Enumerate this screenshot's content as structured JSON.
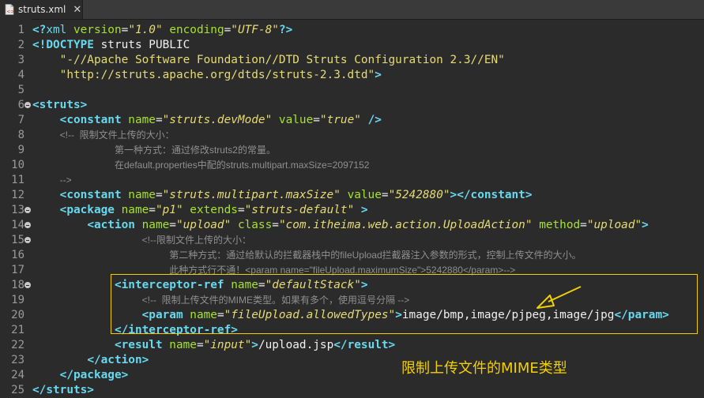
{
  "tab": {
    "title": "struts.xml",
    "close": "✕"
  },
  "lines": [
    {
      "n": "1",
      "indent": "",
      "segs": [
        [
          "t-tag",
          "<?"
        ],
        [
          "t-kw",
          "xml "
        ],
        [
          "t-attr",
          "version"
        ],
        [
          "t-b",
          "="
        ],
        [
          "t-val",
          "\"1.0\""
        ],
        [
          "t-b",
          " "
        ],
        [
          "t-attr",
          "encoding"
        ],
        [
          "t-b",
          "="
        ],
        [
          "t-val",
          "\"UTF-8\""
        ],
        [
          "t-tag",
          "?>"
        ]
      ]
    },
    {
      "n": "2",
      "indent": "",
      "segs": [
        [
          "t-tag",
          "<!DOCTYPE "
        ],
        [
          "t-b",
          "struts PUBLIC"
        ]
      ]
    },
    {
      "n": "3",
      "indent": "    ",
      "segs": [
        [
          "t-str",
          "\"-//Apache Software Foundation//DTD Struts Configuration 2.3//EN\""
        ]
      ]
    },
    {
      "n": "4",
      "indent": "    ",
      "segs": [
        [
          "t-str",
          "\"http://struts.apache.org/dtds/struts-2.3.dtd\""
        ],
        [
          "t-tag",
          ">"
        ]
      ]
    },
    {
      "n": "5",
      "indent": "",
      "segs": []
    },
    {
      "n": "6",
      "indent": "",
      "fold": true,
      "segs": [
        [
          "t-tag",
          "<struts>"
        ]
      ]
    },
    {
      "n": "7",
      "indent": "    ",
      "segs": [
        [
          "t-tag",
          "<constant "
        ],
        [
          "t-attr",
          "name"
        ],
        [
          "t-b",
          "="
        ],
        [
          "t-val",
          "\"struts.devMode\""
        ],
        [
          "t-b",
          " "
        ],
        [
          "t-attr",
          "value"
        ],
        [
          "t-b",
          "="
        ],
        [
          "t-val",
          "\"true\""
        ],
        [
          "t-b",
          " "
        ],
        [
          "t-tag",
          "/>"
        ]
      ]
    },
    {
      "n": "8",
      "indent": "    ",
      "comment": true,
      "segs": [
        [
          "t-c",
          "<!--  限制文件上传的大小："
        ]
      ]
    },
    {
      "n": "9",
      "indent": "            ",
      "comment": true,
      "segs": [
        [
          "t-c",
          "第一种方式：通过修改struts2的常量。"
        ]
      ]
    },
    {
      "n": "10",
      "indent": "            ",
      "comment": true,
      "segs": [
        [
          "t-c",
          "在default.properties中配的struts.multipart.maxSize=2097152"
        ]
      ]
    },
    {
      "n": "11",
      "indent": "    ",
      "comment": true,
      "segs": [
        [
          "t-c",
          "-->"
        ]
      ]
    },
    {
      "n": "12",
      "indent": "    ",
      "segs": [
        [
          "t-tag",
          "<constant "
        ],
        [
          "t-attr",
          "name"
        ],
        [
          "t-b",
          "="
        ],
        [
          "t-val",
          "\"struts.multipart.maxSize\""
        ],
        [
          "t-b",
          " "
        ],
        [
          "t-attr",
          "value"
        ],
        [
          "t-b",
          "="
        ],
        [
          "t-val",
          "\"5242880\""
        ],
        [
          "t-tag",
          "></constant>"
        ]
      ]
    },
    {
      "n": "13",
      "indent": "    ",
      "fold": true,
      "segs": [
        [
          "t-tag",
          "<package "
        ],
        [
          "t-attr",
          "name"
        ],
        [
          "t-b",
          "="
        ],
        [
          "t-val",
          "\"p1\""
        ],
        [
          "t-b",
          " "
        ],
        [
          "t-attr",
          "extends"
        ],
        [
          "t-b",
          "="
        ],
        [
          "t-val",
          "\"struts-default\""
        ],
        [
          "t-b",
          " "
        ],
        [
          "t-tag",
          ">"
        ]
      ]
    },
    {
      "n": "14",
      "indent": "        ",
      "fold": true,
      "segs": [
        [
          "t-tag",
          "<action "
        ],
        [
          "t-attr",
          "name"
        ],
        [
          "t-b",
          "="
        ],
        [
          "t-val",
          "\"upload\""
        ],
        [
          "t-b",
          " "
        ],
        [
          "t-attr",
          "class"
        ],
        [
          "t-b",
          "="
        ],
        [
          "t-val",
          "\"com.itheima.web.action.UploadAction\""
        ],
        [
          "t-b",
          " "
        ],
        [
          "t-attr",
          "method"
        ],
        [
          "t-b",
          "="
        ],
        [
          "t-val",
          "\"upload\""
        ],
        [
          "t-tag",
          ">"
        ]
      ]
    },
    {
      "n": "15",
      "indent": "                ",
      "fold": true,
      "comment": true,
      "segs": [
        [
          "t-c",
          "<!--限制文件上传的大小："
        ]
      ]
    },
    {
      "n": "16",
      "indent": "                    ",
      "comment": true,
      "segs": [
        [
          "t-c",
          "第二种方式：通过给默认的拦截器栈中的fileUpload拦截器注入参数的形式，控制上传文件的大小。"
        ]
      ]
    },
    {
      "n": "17",
      "indent": "                    ",
      "comment": true,
      "segs": [
        [
          "t-c",
          "此种方式行不通！<param name=\"fileUpload.maximumSize\">5242880</param>-->"
        ]
      ]
    },
    {
      "n": "18",
      "indent": "            ",
      "fold": true,
      "segs": [
        [
          "t-tag",
          "<interceptor-ref "
        ],
        [
          "t-attr",
          "name"
        ],
        [
          "t-b",
          "="
        ],
        [
          "t-val",
          "\"defaultStack\""
        ],
        [
          "t-tag",
          ">"
        ]
      ]
    },
    {
      "n": "19",
      "indent": "                ",
      "comment": true,
      "segs": [
        [
          "t-c",
          "<!--  限制上传文件的MIME类型。如果有多个，使用逗号分隔 -->"
        ]
      ]
    },
    {
      "n": "20",
      "indent": "                ",
      "segs": [
        [
          "t-tag",
          "<param "
        ],
        [
          "t-attr",
          "name"
        ],
        [
          "t-b",
          "="
        ],
        [
          "t-val",
          "\"fileUpload.allowedTypes\""
        ],
        [
          "t-tag",
          ">"
        ],
        [
          "t-b",
          "image/bmp,image/pjpeg,image/jpg"
        ],
        [
          "t-tag",
          "</param>"
        ]
      ]
    },
    {
      "n": "21",
      "indent": "            ",
      "segs": [
        [
          "t-tag",
          "</interceptor-ref>"
        ]
      ]
    },
    {
      "n": "22",
      "indent": "            ",
      "segs": [
        [
          "t-tag",
          "<result "
        ],
        [
          "t-attr",
          "name"
        ],
        [
          "t-b",
          "="
        ],
        [
          "t-val",
          "\"input\""
        ],
        [
          "t-tag",
          ">"
        ],
        [
          "t-b",
          "/upload.jsp"
        ],
        [
          "t-tag",
          "</result>"
        ]
      ]
    },
    {
      "n": "23",
      "indent": "        ",
      "segs": [
        [
          "t-tag",
          "</action>"
        ]
      ]
    },
    {
      "n": "24",
      "indent": "    ",
      "segs": [
        [
          "t-tag",
          "</package>"
        ]
      ]
    },
    {
      "n": "25",
      "indent": "",
      "segs": [
        [
          "t-tag",
          "</struts>"
        ]
      ]
    }
  ],
  "annotation": "限制上传文件的MIME类型",
  "colors": {
    "background": "#2b2b2b",
    "tag": "#66d9ef",
    "attr": "#a6e22e",
    "value": "#e6db74",
    "comment": "#8f8f8f",
    "highlight": "#f0d000"
  }
}
